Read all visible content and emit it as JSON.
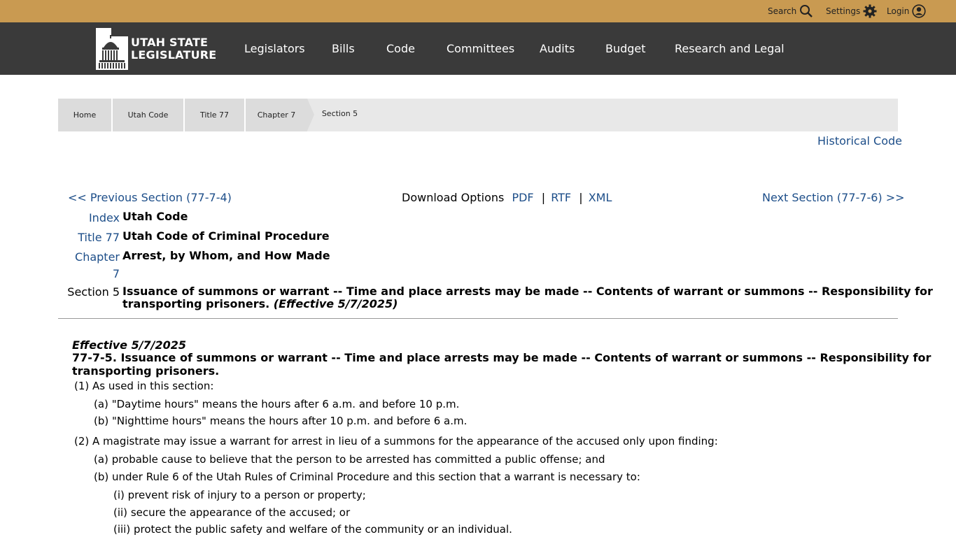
{
  "top_utility": {
    "search_label": "Search",
    "settings_label": "Settings",
    "login_label": "Login"
  },
  "logo": {
    "line1": "UTAH STATE",
    "line2": "LEGISLATURE"
  },
  "nav": {
    "items": [
      "Legislators",
      "Bills",
      "Code",
      "Committees",
      "Audits",
      "Budget",
      "Research and Legal"
    ]
  },
  "breadcrumb": {
    "items": [
      "Home",
      "Utah Code",
      "Title 77",
      "Chapter 7",
      "Section 5"
    ]
  },
  "historical_code_label": "Historical Code",
  "section_nav": {
    "previous": "<< Previous Section (77-7-4)",
    "download_label": "Download Options",
    "pdf": "PDF",
    "rtf": "RTF",
    "xml": "XML",
    "sep": "|",
    "next": "Next Section (77-7-6) >>"
  },
  "header_table": {
    "index_label": "Index",
    "index_value": "Utah Code",
    "title_label": "Title 77",
    "title_value": "Utah Code of Criminal Procedure",
    "chapter_label": "Chapter",
    "chapter_num": "7",
    "chapter_value": "Arrest, by Whom, and How Made",
    "section_label": "Section 5",
    "section_value_line1": "Issuance of summons or warrant -- Time and place arrests may be made -- Contents of warrant or summons -- Responsibility for",
    "section_value_line2": "transporting prisoners.",
    "section_effective": "(Effective 5/7/2025)"
  },
  "content": {
    "effective": "Effective 5/7/2025",
    "heading_line1": "77-7-5.  Issuance of summons or warrant -- Time and place arrests may be made -- Contents of warrant or summons -- Responsibility for",
    "heading_line2": "transporting prisoners.",
    "p1_num": "(1)",
    "p1_text": "As used in this section:",
    "p1a_num": "(a)",
    "p1a_text": "\"Daytime hours\" means the hours after 6 a.m. and before 10 p.m.",
    "p1b_num": "(b)",
    "p1b_text": "\"Nighttime hours\" means the hours after 10 p.m. and before 6 a.m.",
    "p2_num": "(2)",
    "p2_text": "A magistrate may issue a warrant for arrest in lieu of a summons for the appearance of the accused only upon finding:",
    "p2a_num": "(a)",
    "p2a_text": "probable cause to believe that the person to be arrested has committed a public offense; and",
    "p2b_num": "(b)",
    "p2b_text": "under Rule 6 of the Utah Rules of Criminal Procedure and this section that a warrant is necessary to:",
    "p2bi_num": "(i)",
    "p2bi_text": "prevent risk of injury to a person or property;",
    "p2bii_num": "(ii)",
    "p2bii_text": "secure the appearance of the accused; or",
    "p2biii_num": "(iii)",
    "p2biii_text": "protect the public safety and welfare of the community or an individual."
  },
  "colors": {
    "topbar": "#c99a51",
    "navbar": "#3a3a3a",
    "link": "#1d4e89"
  }
}
